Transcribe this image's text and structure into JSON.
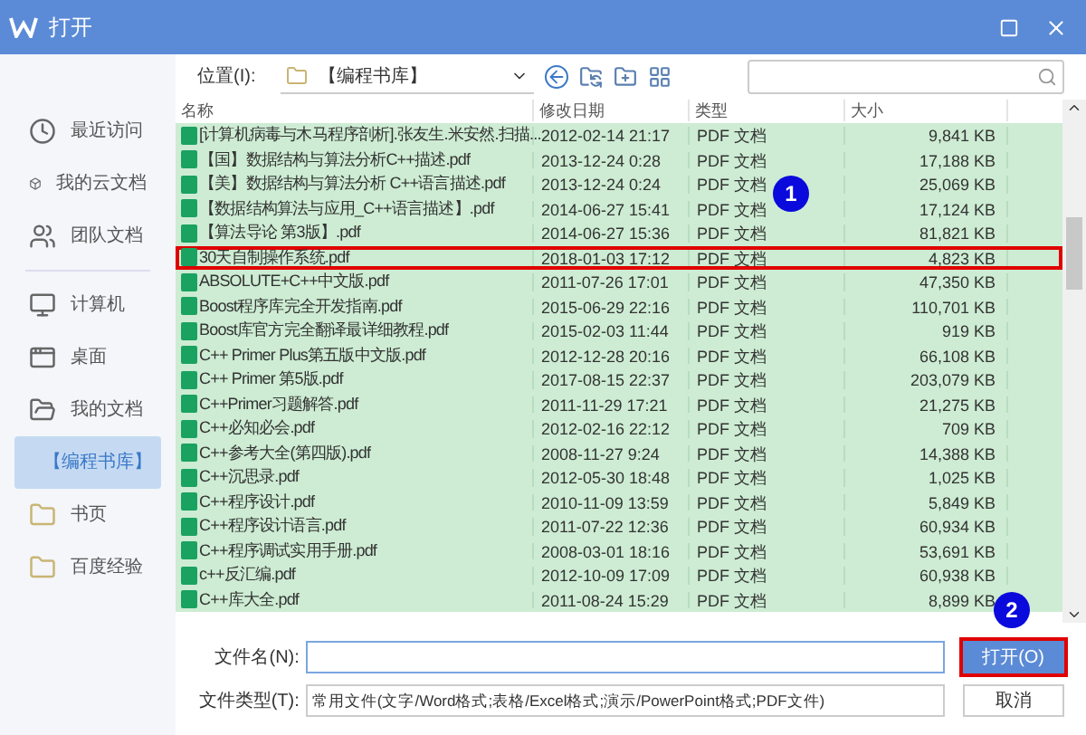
{
  "window": {
    "title": "打开"
  },
  "sidebar": {
    "items": [
      {
        "label": "最近访问",
        "selected": false
      },
      {
        "label": "我的云文档",
        "selected": false
      },
      {
        "label": "团队文档",
        "selected": false
      },
      {
        "label": "计算机",
        "selected": false
      },
      {
        "label": "桌面",
        "selected": false
      },
      {
        "label": "我的文档",
        "selected": false
      },
      {
        "label": "【编程书库】",
        "selected": true
      },
      {
        "label": "书页",
        "selected": false
      },
      {
        "label": "百度经验",
        "selected": false
      }
    ]
  },
  "location": {
    "label": "位置(I):",
    "value": "【编程书库】"
  },
  "table": {
    "columns": [
      "名称",
      "修改日期",
      "类型",
      "大小"
    ],
    "rows": [
      {
        "name": "[计算机病毒与木马程序剖析].张友生.米安然.扫描...",
        "date": "2012-02-14 21:17",
        "type": "PDF 文档",
        "size": "9,841 KB",
        "highlighted": false
      },
      {
        "name": "【国】数据结构与算法分析C++描述.pdf",
        "date": "2013-12-24 0:28",
        "type": "PDF 文档",
        "size": "17,188 KB",
        "highlighted": false
      },
      {
        "name": "【美】数据结构与算法分析 C++语言描述.pdf",
        "date": "2013-12-24 0:24",
        "type": "PDF 文档",
        "size": "25,069 KB",
        "highlighted": false
      },
      {
        "name": "【数据结构算法与应用_C++语言描述】.pdf",
        "date": "2014-06-27 15:41",
        "type": "PDF 文档",
        "size": "17,124 KB",
        "highlighted": false
      },
      {
        "name": "【算法导论 第3版】.pdf",
        "date": "2014-06-27 15:36",
        "type": "PDF 文档",
        "size": "81,821 KB",
        "highlighted": false
      },
      {
        "name": "30天自制操作系统.pdf",
        "date": "2018-01-03 17:12",
        "type": "PDF 文档",
        "size": "4,823 KB",
        "highlighted": true
      },
      {
        "name": "ABSOLUTE+C++中文版.pdf",
        "date": "2011-07-26 17:01",
        "type": "PDF 文档",
        "size": "47,350 KB",
        "highlighted": false
      },
      {
        "name": "Boost程序库完全开发指南.pdf",
        "date": "2015-06-29 22:16",
        "type": "PDF 文档",
        "size": "110,701 KB",
        "highlighted": false
      },
      {
        "name": "Boost库官方完全翻译最详细教程.pdf",
        "date": "2015-02-03 11:44",
        "type": "PDF 文档",
        "size": "919 KB",
        "highlighted": false
      },
      {
        "name": "C++ Primer Plus第五版中文版.pdf",
        "date": "2012-12-28 20:16",
        "type": "PDF 文档",
        "size": "66,108 KB",
        "highlighted": false
      },
      {
        "name": "C++ Primer 第5版.pdf",
        "date": "2017-08-15 22:37",
        "type": "PDF 文档",
        "size": "203,079 KB",
        "highlighted": false
      },
      {
        "name": "C++Primer习题解答.pdf",
        "date": "2011-11-29 17:21",
        "type": "PDF 文档",
        "size": "21,275 KB",
        "highlighted": false
      },
      {
        "name": "C++必知必会.pdf",
        "date": "2012-02-16 22:12",
        "type": "PDF 文档",
        "size": "709 KB",
        "highlighted": false
      },
      {
        "name": "C++参考大全(第四版).pdf",
        "date": "2008-11-27 9:24",
        "type": "PDF 文档",
        "size": "14,388 KB",
        "highlighted": false
      },
      {
        "name": "C++沉思录.pdf",
        "date": "2012-05-30 18:48",
        "type": "PDF 文档",
        "size": "1,025 KB",
        "highlighted": false
      },
      {
        "name": "C++程序设计.pdf",
        "date": "2010-11-09 13:59",
        "type": "PDF 文档",
        "size": "5,849 KB",
        "highlighted": false
      },
      {
        "name": "C++程序设计语言.pdf",
        "date": "2011-07-22 12:36",
        "type": "PDF 文档",
        "size": "60,934 KB",
        "highlighted": false
      },
      {
        "name": "C++程序调试实用手册.pdf",
        "date": "2008-03-01 18:16",
        "type": "PDF 文档",
        "size": "53,691 KB",
        "highlighted": false
      },
      {
        "name": "c++反汇编.pdf",
        "date": "2012-10-09 17:09",
        "type": "PDF 文档",
        "size": "60,938 KB",
        "highlighted": false
      },
      {
        "name": "C++库大全.pdf",
        "date": "2011-08-24 15:29",
        "type": "PDF 文档",
        "size": "8,899 KB",
        "highlighted": false
      }
    ]
  },
  "markers": [
    "1",
    "2"
  ],
  "file_name": {
    "label": "文件名(N):"
  },
  "file_type": {
    "label": "文件类型(T):",
    "value": "常用文件(文字/Word格式;表格/Excel格式;演示/PowerPoint格式;PDF文件)"
  },
  "buttons": [
    {
      "label": "打开(O)",
      "highlighted": true
    },
    {
      "label": "取消",
      "highlighted": false
    }
  ]
}
